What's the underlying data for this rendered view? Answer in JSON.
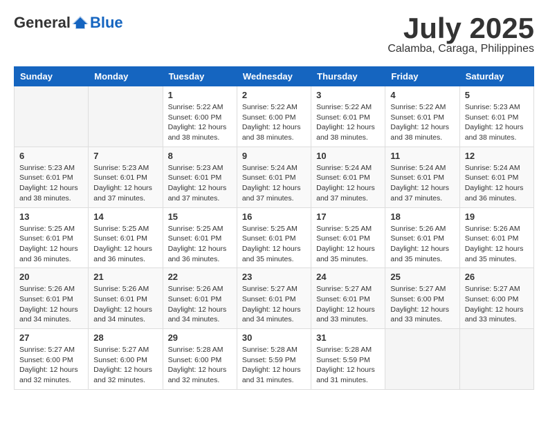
{
  "logo": {
    "general": "General",
    "blue": "Blue"
  },
  "header": {
    "month": "July 2025",
    "location": "Calamba, Caraga, Philippines"
  },
  "weekdays": [
    "Sunday",
    "Monday",
    "Tuesday",
    "Wednesday",
    "Thursday",
    "Friday",
    "Saturday"
  ],
  "weeks": [
    [
      {
        "day": null
      },
      {
        "day": null
      },
      {
        "day": "1",
        "sunrise": "Sunrise: 5:22 AM",
        "sunset": "Sunset: 6:00 PM",
        "daylight": "Daylight: 12 hours and 38 minutes."
      },
      {
        "day": "2",
        "sunrise": "Sunrise: 5:22 AM",
        "sunset": "Sunset: 6:00 PM",
        "daylight": "Daylight: 12 hours and 38 minutes."
      },
      {
        "day": "3",
        "sunrise": "Sunrise: 5:22 AM",
        "sunset": "Sunset: 6:01 PM",
        "daylight": "Daylight: 12 hours and 38 minutes."
      },
      {
        "day": "4",
        "sunrise": "Sunrise: 5:22 AM",
        "sunset": "Sunset: 6:01 PM",
        "daylight": "Daylight: 12 hours and 38 minutes."
      },
      {
        "day": "5",
        "sunrise": "Sunrise: 5:23 AM",
        "sunset": "Sunset: 6:01 PM",
        "daylight": "Daylight: 12 hours and 38 minutes."
      }
    ],
    [
      {
        "day": "6",
        "sunrise": "Sunrise: 5:23 AM",
        "sunset": "Sunset: 6:01 PM",
        "daylight": "Daylight: 12 hours and 38 minutes."
      },
      {
        "day": "7",
        "sunrise": "Sunrise: 5:23 AM",
        "sunset": "Sunset: 6:01 PM",
        "daylight": "Daylight: 12 hours and 37 minutes."
      },
      {
        "day": "8",
        "sunrise": "Sunrise: 5:23 AM",
        "sunset": "Sunset: 6:01 PM",
        "daylight": "Daylight: 12 hours and 37 minutes."
      },
      {
        "day": "9",
        "sunrise": "Sunrise: 5:24 AM",
        "sunset": "Sunset: 6:01 PM",
        "daylight": "Daylight: 12 hours and 37 minutes."
      },
      {
        "day": "10",
        "sunrise": "Sunrise: 5:24 AM",
        "sunset": "Sunset: 6:01 PM",
        "daylight": "Daylight: 12 hours and 37 minutes."
      },
      {
        "day": "11",
        "sunrise": "Sunrise: 5:24 AM",
        "sunset": "Sunset: 6:01 PM",
        "daylight": "Daylight: 12 hours and 37 minutes."
      },
      {
        "day": "12",
        "sunrise": "Sunrise: 5:24 AM",
        "sunset": "Sunset: 6:01 PM",
        "daylight": "Daylight: 12 hours and 36 minutes."
      }
    ],
    [
      {
        "day": "13",
        "sunrise": "Sunrise: 5:25 AM",
        "sunset": "Sunset: 6:01 PM",
        "daylight": "Daylight: 12 hours and 36 minutes."
      },
      {
        "day": "14",
        "sunrise": "Sunrise: 5:25 AM",
        "sunset": "Sunset: 6:01 PM",
        "daylight": "Daylight: 12 hours and 36 minutes."
      },
      {
        "day": "15",
        "sunrise": "Sunrise: 5:25 AM",
        "sunset": "Sunset: 6:01 PM",
        "daylight": "Daylight: 12 hours and 36 minutes."
      },
      {
        "day": "16",
        "sunrise": "Sunrise: 5:25 AM",
        "sunset": "Sunset: 6:01 PM",
        "daylight": "Daylight: 12 hours and 35 minutes."
      },
      {
        "day": "17",
        "sunrise": "Sunrise: 5:25 AM",
        "sunset": "Sunset: 6:01 PM",
        "daylight": "Daylight: 12 hours and 35 minutes."
      },
      {
        "day": "18",
        "sunrise": "Sunrise: 5:26 AM",
        "sunset": "Sunset: 6:01 PM",
        "daylight": "Daylight: 12 hours and 35 minutes."
      },
      {
        "day": "19",
        "sunrise": "Sunrise: 5:26 AM",
        "sunset": "Sunset: 6:01 PM",
        "daylight": "Daylight: 12 hours and 35 minutes."
      }
    ],
    [
      {
        "day": "20",
        "sunrise": "Sunrise: 5:26 AM",
        "sunset": "Sunset: 6:01 PM",
        "daylight": "Daylight: 12 hours and 34 minutes."
      },
      {
        "day": "21",
        "sunrise": "Sunrise: 5:26 AM",
        "sunset": "Sunset: 6:01 PM",
        "daylight": "Daylight: 12 hours and 34 minutes."
      },
      {
        "day": "22",
        "sunrise": "Sunrise: 5:26 AM",
        "sunset": "Sunset: 6:01 PM",
        "daylight": "Daylight: 12 hours and 34 minutes."
      },
      {
        "day": "23",
        "sunrise": "Sunrise: 5:27 AM",
        "sunset": "Sunset: 6:01 PM",
        "daylight": "Daylight: 12 hours and 34 minutes."
      },
      {
        "day": "24",
        "sunrise": "Sunrise: 5:27 AM",
        "sunset": "Sunset: 6:01 PM",
        "daylight": "Daylight: 12 hours and 33 minutes."
      },
      {
        "day": "25",
        "sunrise": "Sunrise: 5:27 AM",
        "sunset": "Sunset: 6:00 PM",
        "daylight": "Daylight: 12 hours and 33 minutes."
      },
      {
        "day": "26",
        "sunrise": "Sunrise: 5:27 AM",
        "sunset": "Sunset: 6:00 PM",
        "daylight": "Daylight: 12 hours and 33 minutes."
      }
    ],
    [
      {
        "day": "27",
        "sunrise": "Sunrise: 5:27 AM",
        "sunset": "Sunset: 6:00 PM",
        "daylight": "Daylight: 12 hours and 32 minutes."
      },
      {
        "day": "28",
        "sunrise": "Sunrise: 5:27 AM",
        "sunset": "Sunset: 6:00 PM",
        "daylight": "Daylight: 12 hours and 32 minutes."
      },
      {
        "day": "29",
        "sunrise": "Sunrise: 5:28 AM",
        "sunset": "Sunset: 6:00 PM",
        "daylight": "Daylight: 12 hours and 32 minutes."
      },
      {
        "day": "30",
        "sunrise": "Sunrise: 5:28 AM",
        "sunset": "Sunset: 5:59 PM",
        "daylight": "Daylight: 12 hours and 31 minutes."
      },
      {
        "day": "31",
        "sunrise": "Sunrise: 5:28 AM",
        "sunset": "Sunset: 5:59 PM",
        "daylight": "Daylight: 12 hours and 31 minutes."
      },
      {
        "day": null
      },
      {
        "day": null
      }
    ]
  ]
}
